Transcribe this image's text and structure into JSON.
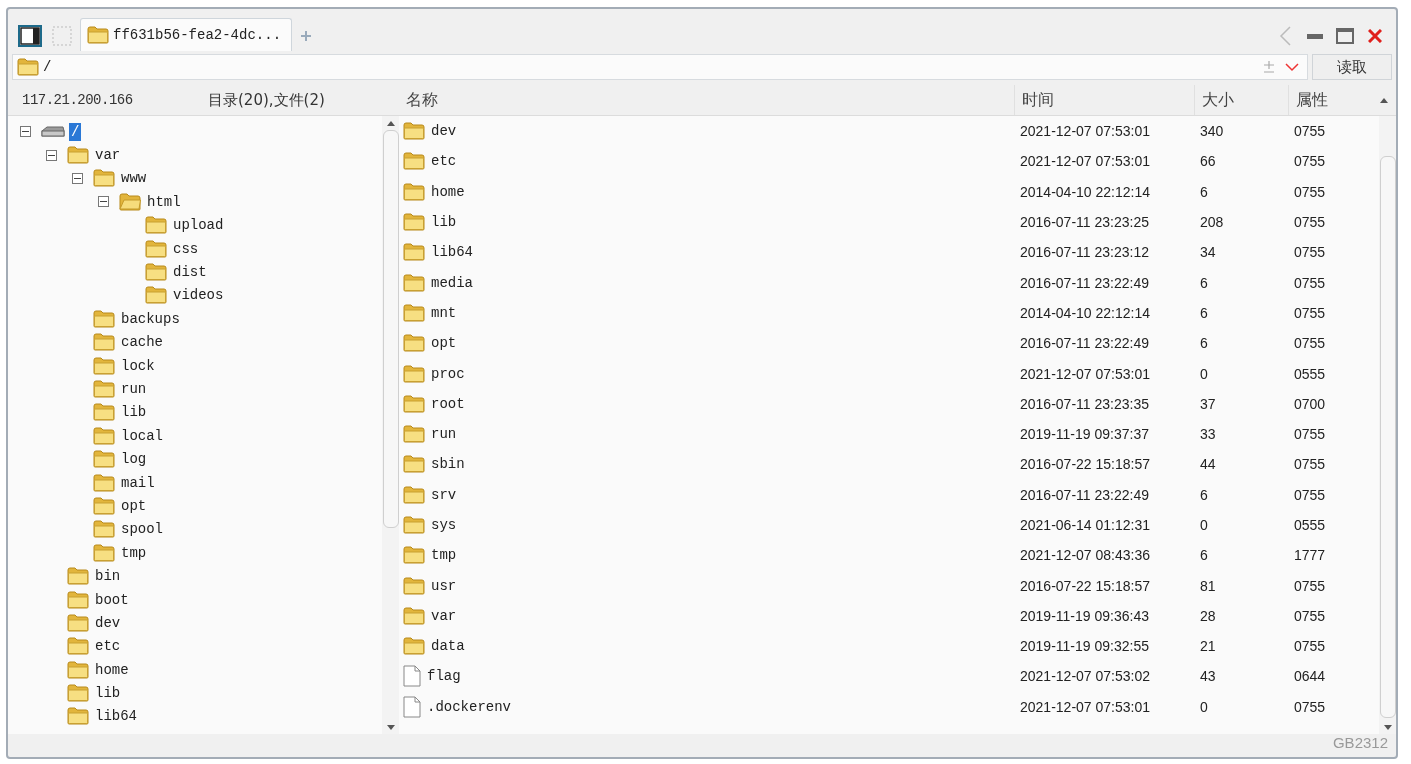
{
  "tabs": [
    {
      "title": "ff631b56-fea2-4dc...",
      "selected": true
    }
  ],
  "address": {
    "value": "/",
    "button": "读取"
  },
  "tree_header": {
    "host": "117.21.200.166",
    "counts": "目录(20),文件(2)"
  },
  "tree": [
    {
      "label": "/",
      "kind": "drive",
      "selected": true,
      "expanded": true,
      "children": [
        {
          "label": "var",
          "kind": "folder",
          "selected": false,
          "expanded": true,
          "children": [
            {
              "label": "www",
              "kind": "folder",
              "selected": false,
              "expanded": true,
              "children": [
                {
                  "label": "html",
                  "kind": "open-folder",
                  "selected": false,
                  "expanded": true,
                  "children": [
                    {
                      "label": "upload",
                      "kind": "folder",
                      "selected": false
                    },
                    {
                      "label": "css",
                      "kind": "folder",
                      "selected": false
                    },
                    {
                      "label": "dist",
                      "kind": "folder",
                      "selected": false
                    },
                    {
                      "label": "videos",
                      "kind": "folder",
                      "selected": false
                    }
                  ]
                }
              ]
            },
            {
              "label": "backups",
              "kind": "folder",
              "selected": false
            },
            {
              "label": "cache",
              "kind": "folder",
              "selected": false
            },
            {
              "label": "lock",
              "kind": "folder",
              "selected": false
            },
            {
              "label": "run",
              "kind": "folder",
              "selected": false
            },
            {
              "label": "lib",
              "kind": "folder",
              "selected": false
            },
            {
              "label": "local",
              "kind": "folder",
              "selected": false
            },
            {
              "label": "log",
              "kind": "folder",
              "selected": false
            },
            {
              "label": "mail",
              "kind": "folder",
              "selected": false
            },
            {
              "label": "opt",
              "kind": "folder",
              "selected": false
            },
            {
              "label": "spool",
              "kind": "folder",
              "selected": false
            },
            {
              "label": "tmp",
              "kind": "folder",
              "selected": false
            }
          ]
        },
        {
          "label": "bin",
          "kind": "folder",
          "selected": false
        },
        {
          "label": "boot",
          "kind": "folder",
          "selected": false
        },
        {
          "label": "dev",
          "kind": "folder",
          "selected": false
        },
        {
          "label": "etc",
          "kind": "folder",
          "selected": false
        },
        {
          "label": "home",
          "kind": "folder",
          "selected": false
        },
        {
          "label": "lib",
          "kind": "folder",
          "selected": false
        },
        {
          "label": "lib64",
          "kind": "folder",
          "selected": false
        }
      ]
    }
  ],
  "table": {
    "columns": [
      "名称",
      "时间",
      "大小",
      "属性"
    ],
    "rows": [
      {
        "kind": "folder",
        "name": "dev",
        "time": "2021-12-07 07:53:01",
        "size": "340",
        "attr": "0755"
      },
      {
        "kind": "folder",
        "name": "etc",
        "time": "2021-12-07 07:53:01",
        "size": "66",
        "attr": "0755"
      },
      {
        "kind": "folder",
        "name": "home",
        "time": "2014-04-10 22:12:14",
        "size": "6",
        "attr": "0755"
      },
      {
        "kind": "folder",
        "name": "lib",
        "time": "2016-07-11 23:23:25",
        "size": "208",
        "attr": "0755"
      },
      {
        "kind": "folder",
        "name": "lib64",
        "time": "2016-07-11 23:23:12",
        "size": "34",
        "attr": "0755"
      },
      {
        "kind": "folder",
        "name": "media",
        "time": "2016-07-11 23:22:49",
        "size": "6",
        "attr": "0755"
      },
      {
        "kind": "folder",
        "name": "mnt",
        "time": "2014-04-10 22:12:14",
        "size": "6",
        "attr": "0755"
      },
      {
        "kind": "folder",
        "name": "opt",
        "time": "2016-07-11 23:22:49",
        "size": "6",
        "attr": "0755"
      },
      {
        "kind": "folder",
        "name": "proc",
        "time": "2021-12-07 07:53:01",
        "size": "0",
        "attr": "0555"
      },
      {
        "kind": "folder",
        "name": "root",
        "time": "2016-07-11 23:23:35",
        "size": "37",
        "attr": "0700"
      },
      {
        "kind": "folder",
        "name": "run",
        "time": "2019-11-19 09:37:37",
        "size": "33",
        "attr": "0755"
      },
      {
        "kind": "folder",
        "name": "sbin",
        "time": "2016-07-22 15:18:57",
        "size": "44",
        "attr": "0755"
      },
      {
        "kind": "folder",
        "name": "srv",
        "time": "2016-07-11 23:22:49",
        "size": "6",
        "attr": "0755"
      },
      {
        "kind": "folder",
        "name": "sys",
        "time": "2021-06-14 01:12:31",
        "size": "0",
        "attr": "0555"
      },
      {
        "kind": "folder",
        "name": "tmp",
        "time": "2021-12-07 08:43:36",
        "size": "6",
        "attr": "1777"
      },
      {
        "kind": "folder",
        "name": "usr",
        "time": "2016-07-22 15:18:57",
        "size": "81",
        "attr": "0755"
      },
      {
        "kind": "folder",
        "name": "var",
        "time": "2019-11-19 09:36:43",
        "size": "28",
        "attr": "0755"
      },
      {
        "kind": "folder",
        "name": "data",
        "time": "2019-11-19 09:32:55",
        "size": "21",
        "attr": "0755"
      },
      {
        "kind": "file",
        "name": "flag",
        "time": "2021-12-07 07:53:02",
        "size": "43",
        "attr": "0644"
      },
      {
        "kind": "file",
        "name": ".dockerenv",
        "time": "2021-12-07 07:53:01",
        "size": "0",
        "attr": "0755"
      }
    ]
  },
  "status_bar": {
    "encoding": "GB2312"
  }
}
